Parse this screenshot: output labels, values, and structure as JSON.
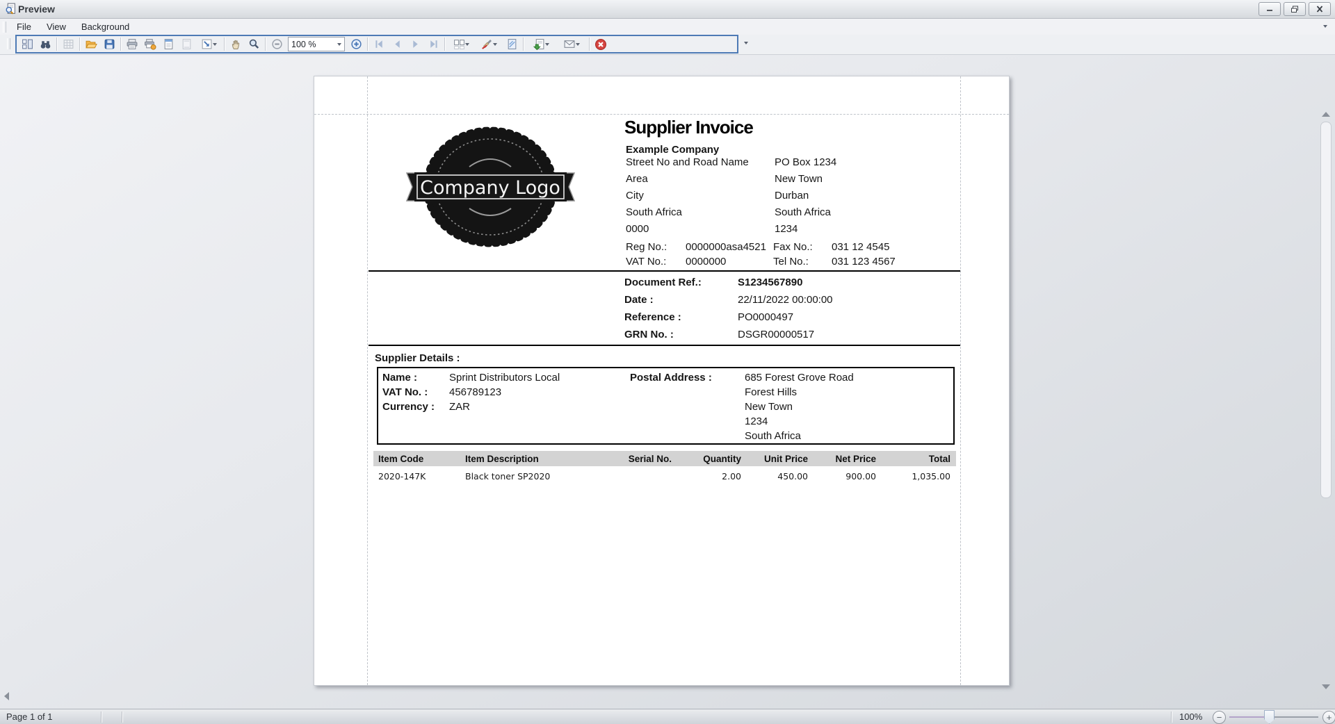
{
  "window": {
    "title": "Preview"
  },
  "menu": {
    "items": [
      "File",
      "View",
      "Background"
    ]
  },
  "toolbar": {
    "zoom_value": "100 %",
    "buttons": [
      "document-map",
      "search",
      "thumbnails",
      "open",
      "save",
      "print",
      "quick-print",
      "page-setup",
      "header-footer",
      "scale",
      "hand-tool",
      "magnifier",
      "zoom-out",
      "zoom",
      "zoom-in",
      "first-page",
      "previous-page",
      "next-page",
      "last-page",
      "multiple-pages",
      "background-color",
      "watermark",
      "export-document",
      "send-email",
      "exit"
    ]
  },
  "colors": {
    "accent_blue": "#4876b5",
    "toolbar_border": "#4d7ab5",
    "exit_red": "#d64541",
    "folder_orange": "#f3b54a",
    "header_gray": "#d3d3d3"
  },
  "invoice": {
    "title": "Supplier Invoice",
    "logo_text": "Company Logo",
    "company": {
      "name": "Example Company",
      "address": {
        "left": [
          "Street No and Road Name",
          "Area",
          "City",
          "South Africa",
          "0000"
        ],
        "right": [
          "PO Box 1234",
          "New Town",
          "Durban",
          "South Africa",
          "1234"
        ]
      },
      "reg": {
        "label": "Reg No.:",
        "value": "0000000asa4521"
      },
      "vat": {
        "label": "VAT No.:",
        "value": "0000000"
      },
      "fax": {
        "label": "Fax No.:",
        "value": "031 12 4545"
      },
      "tel": {
        "label": "Tel No.:",
        "value": "031 123 4567"
      }
    },
    "document_ref": {
      "rows": [
        {
          "label": "Document Ref.:",
          "value": "S1234567890"
        },
        {
          "label": "Date :",
          "value": "22/11/2022 00:00:00"
        },
        {
          "label": "Reference :",
          "value": "PO0000497"
        },
        {
          "label": "GRN No. :",
          "value": "DSGR00000517"
        }
      ]
    },
    "supplier": {
      "heading": "Supplier Details :",
      "fields": [
        {
          "label": "Name :",
          "value": "Sprint Distributors Local"
        },
        {
          "label": "VAT No. :",
          "value": "456789123"
        },
        {
          "label": "Currency :",
          "value": "ZAR"
        }
      ],
      "postal": {
        "label": "Postal Address :",
        "lines": [
          "685 Forest Grove Road",
          "Forest Hills",
          "New Town",
          "1234",
          "South Africa"
        ]
      }
    },
    "items": {
      "columns": [
        "Item Code",
        "Item Description",
        "Serial No.",
        "Quantity",
        "Unit Price",
        "Net Price",
        "Total"
      ],
      "rows": [
        [
          "2020-147K",
          "Black toner SP2020",
          "",
          "2.00",
          "450.00",
          "900.00",
          "1,035.00"
        ]
      ]
    }
  },
  "statusbar": {
    "page_label": "Page 1 of 1",
    "zoom_percent": "100%"
  }
}
